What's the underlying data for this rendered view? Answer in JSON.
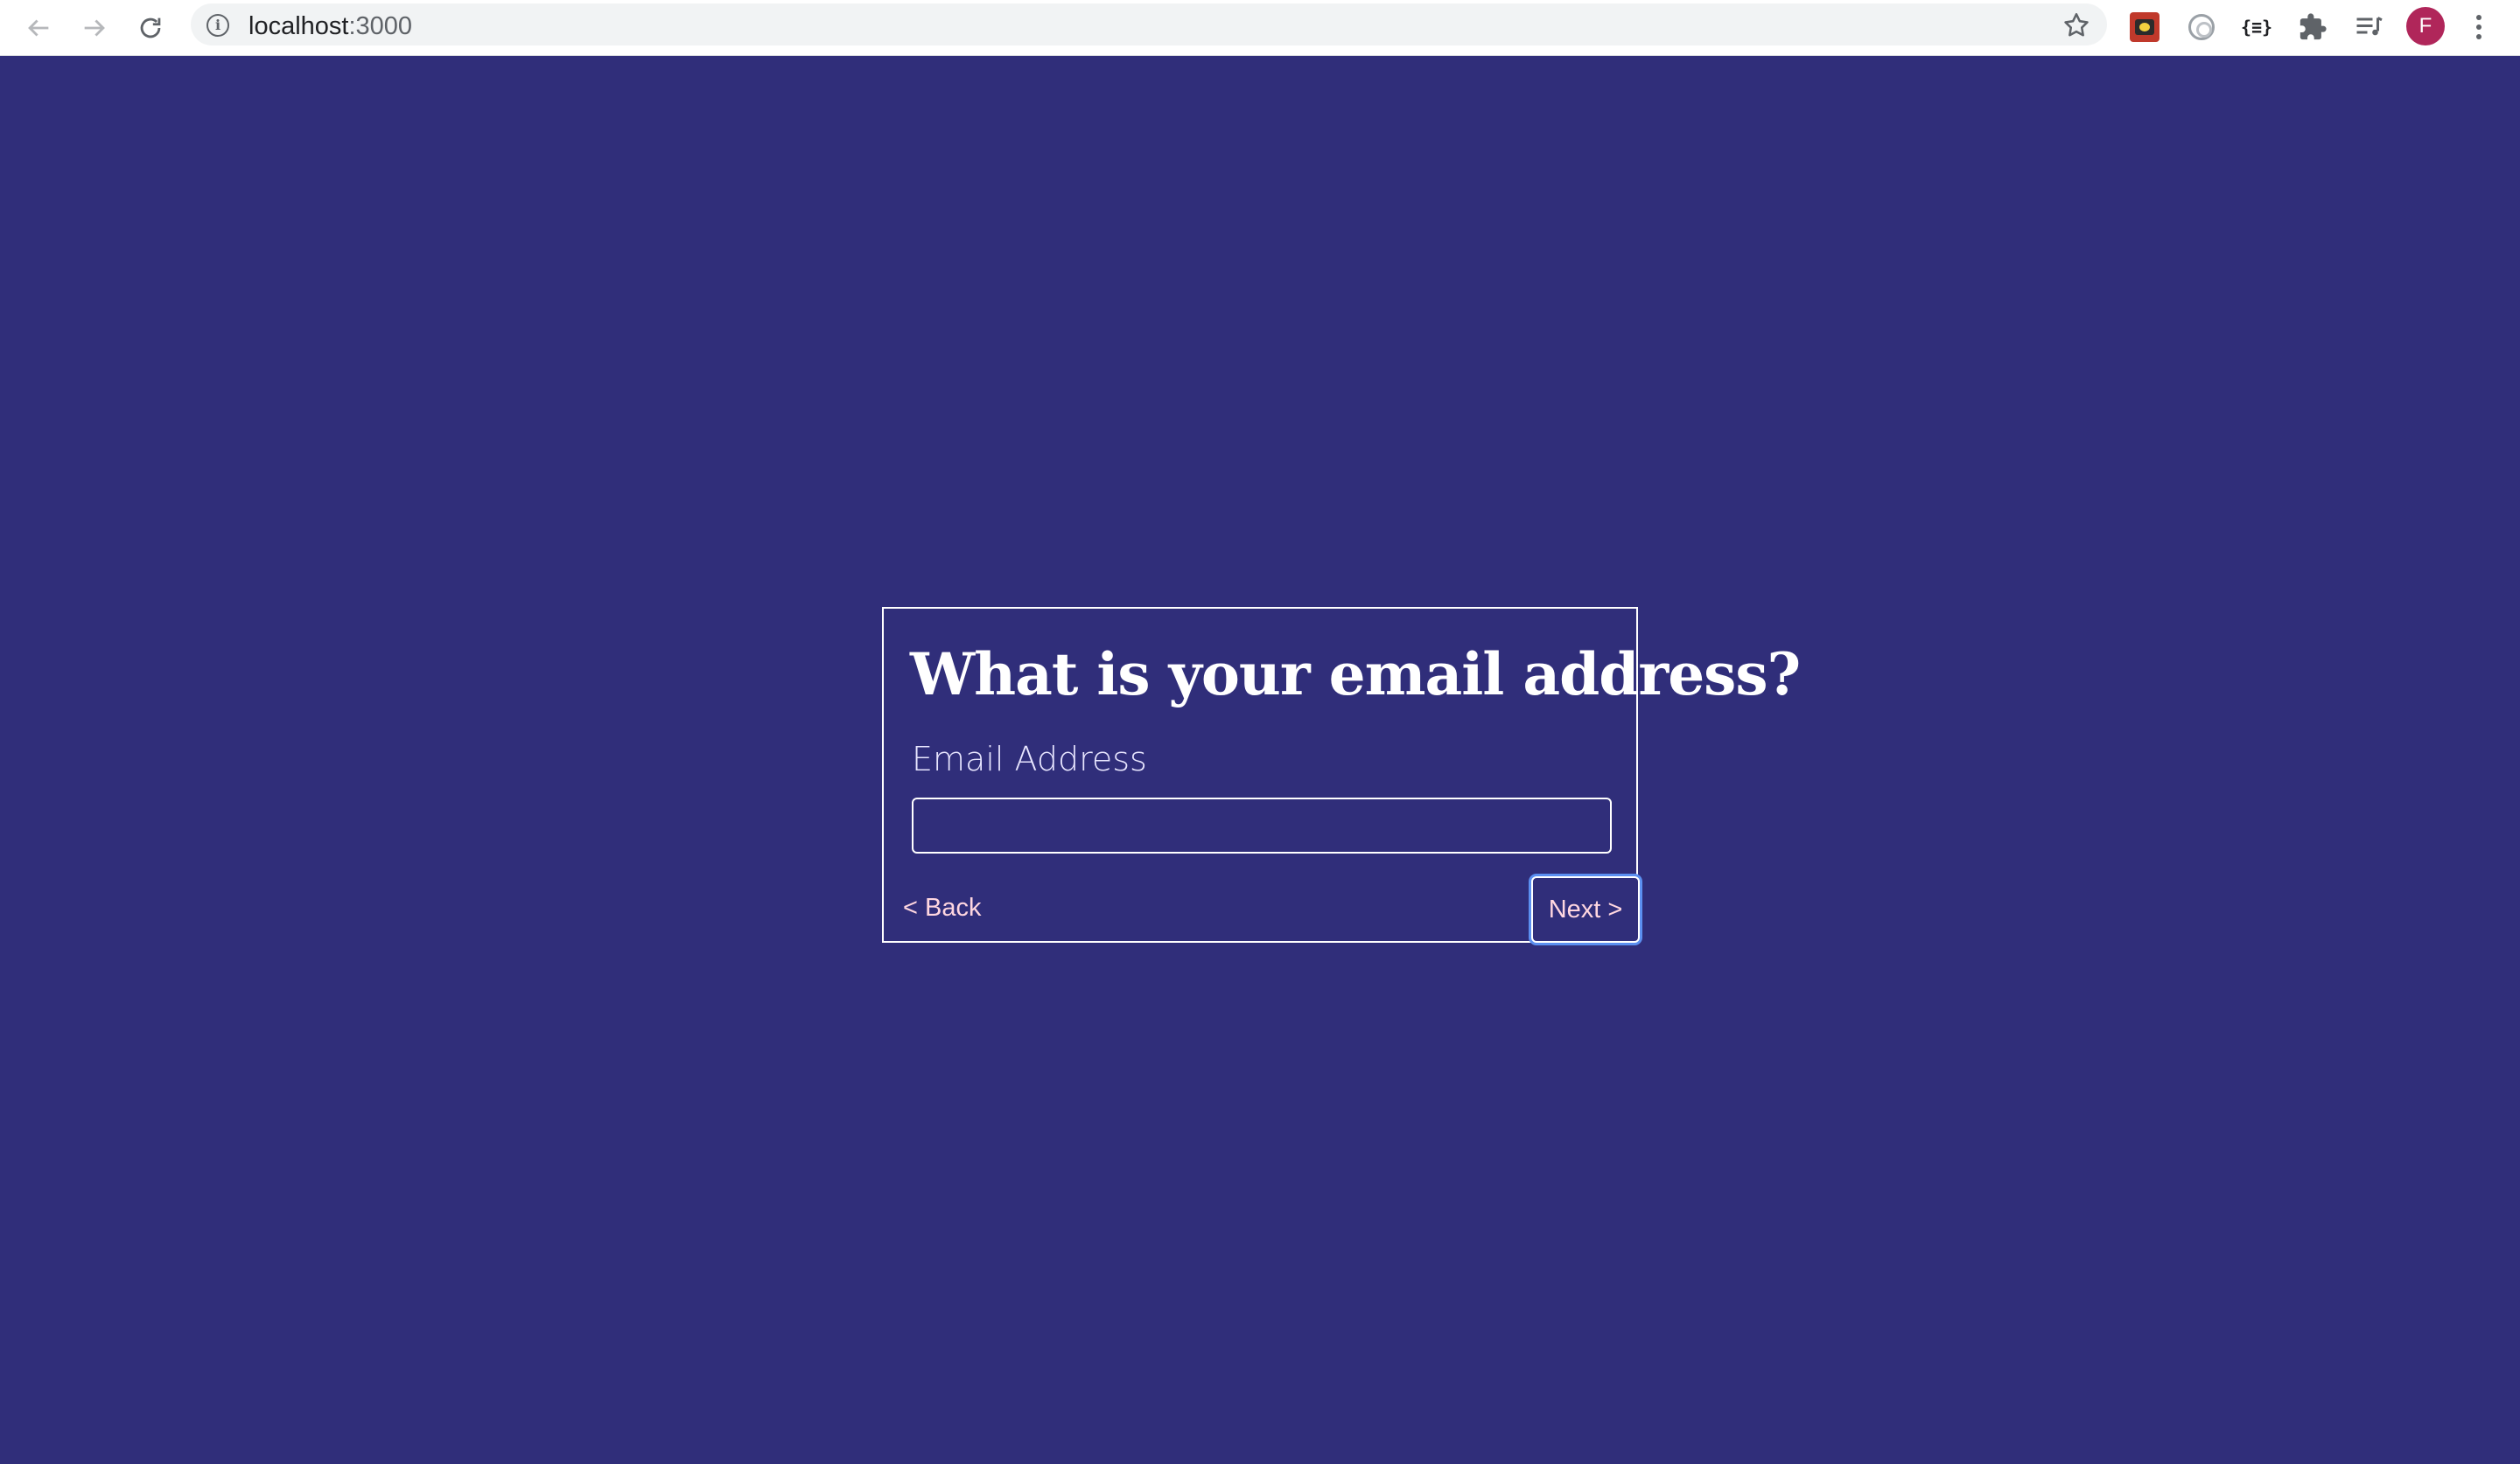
{
  "browser": {
    "url_host": "localhost",
    "url_port": ":3000",
    "avatar_letter": "F",
    "extension_3_label": "{≡}",
    "icons": [
      "back-arrow-icon",
      "forward-arrow-icon",
      "reload-icon",
      "info-icon",
      "star-icon",
      "extension-icon",
      "puzzle-icon",
      "media-queue-icon",
      "menu-icon"
    ]
  },
  "colors": {
    "page_background": "#302e7a",
    "card_border": "#ffffff",
    "link_text": "#ffd7e0",
    "focus_ring": "#5b8ff0",
    "avatar": "#b0265a"
  },
  "form": {
    "title": "What is your email address?",
    "email_label": "Email Address",
    "email_value": "",
    "back_label": "< Back",
    "next_label": "Next >"
  }
}
